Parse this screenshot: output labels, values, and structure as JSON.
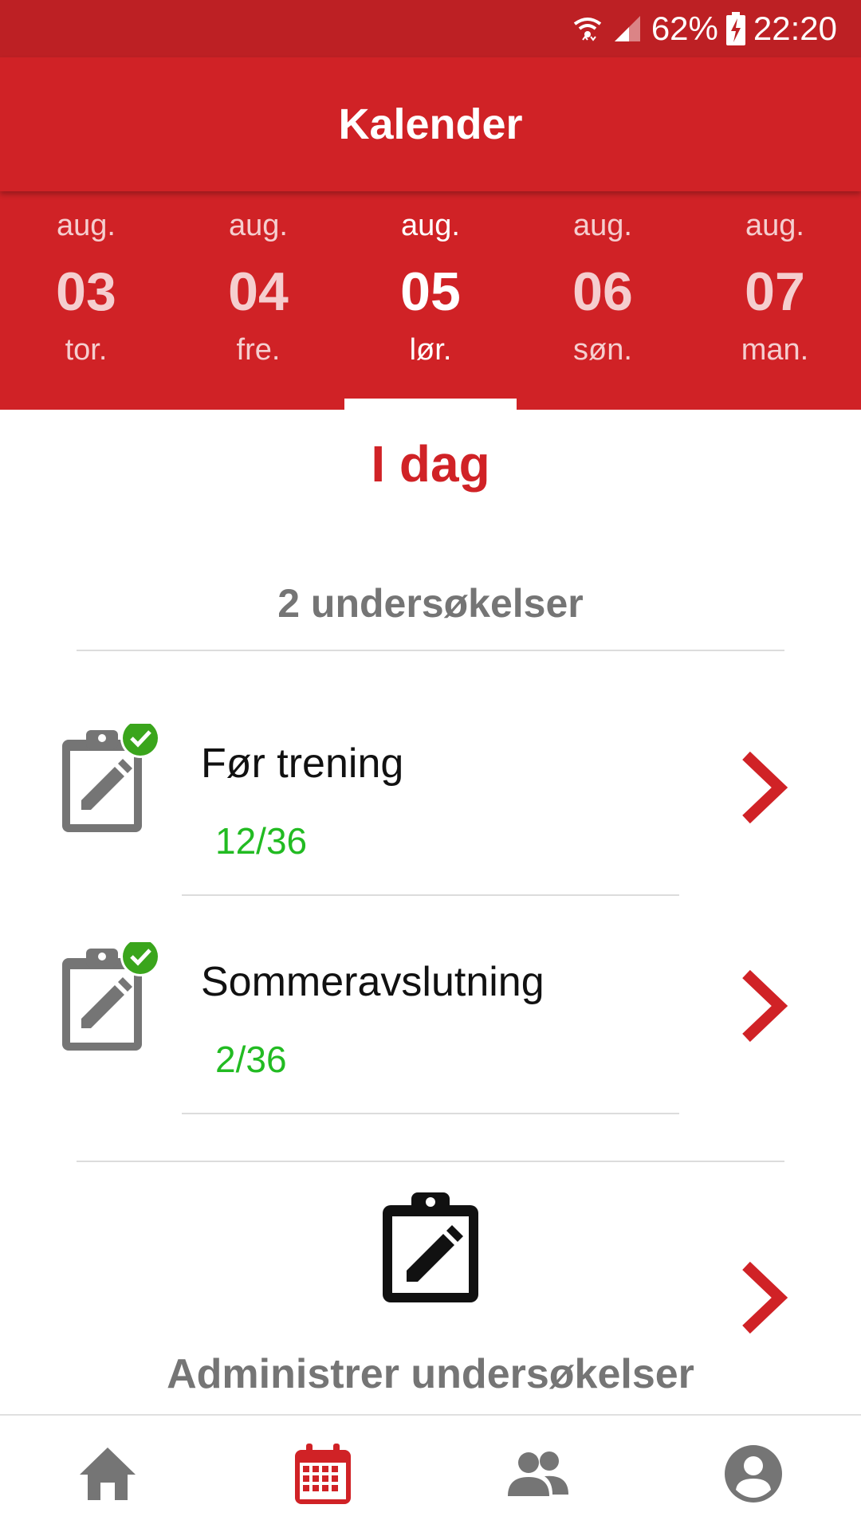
{
  "status_bar": {
    "battery": "62%",
    "time": "22:20"
  },
  "app_bar": {
    "title": "Kalender"
  },
  "date_tabs": [
    {
      "month": "aug.",
      "day": "03",
      "weekday": "tor."
    },
    {
      "month": "aug.",
      "day": "04",
      "weekday": "fre."
    },
    {
      "month": "aug.",
      "day": "05",
      "weekday": "lør."
    },
    {
      "month": "aug.",
      "day": "06",
      "weekday": "søn."
    },
    {
      "month": "aug.",
      "day": "07",
      "weekday": "man."
    }
  ],
  "selected_date_index": 2,
  "main": {
    "today_title": "I dag",
    "survey_count": "2 undersøkelser",
    "surveys": [
      {
        "name": "Før trening",
        "progress": "12/36"
      },
      {
        "name": "Sommeravslutning",
        "progress": "2/36"
      }
    ],
    "admin_label": "Administrer undersøkelser"
  },
  "bottom_nav": [
    {
      "icon": "home-icon"
    },
    {
      "icon": "calendar-icon",
      "active": true
    },
    {
      "icon": "people-icon"
    },
    {
      "icon": "account-circle-icon"
    }
  ],
  "colors": {
    "primary": "#d02226",
    "status_bar": "#bd2024",
    "progress_green": "#22bb22",
    "check_green": "#3aa51c",
    "icon_gray": "#757575"
  }
}
